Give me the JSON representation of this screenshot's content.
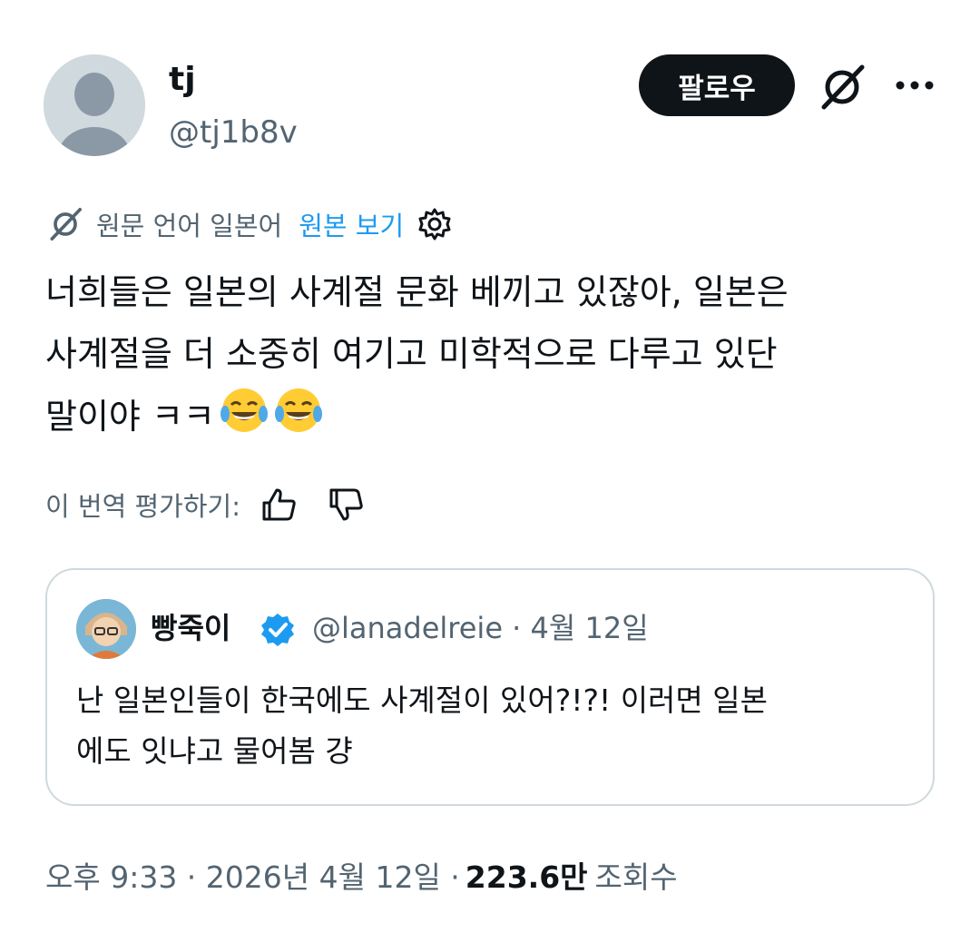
{
  "author": {
    "name": "tj",
    "handle": "@tj1b8v"
  },
  "actions": {
    "follow_label": "팔로우"
  },
  "translation": {
    "source_language": "원문 언어 일본어",
    "view_original": "원본 보기"
  },
  "tweet": {
    "text_line1": "너희들은 일본의 사계절 문화 베끼고 있잖아, 일본은",
    "text_line2": "사계절을 더 소중히 여기고 미학적으로 다루고 있단",
    "text_line3": "말이야 ㅋㅋ",
    "emoji": "face-with-tears-of-joy"
  },
  "rating": {
    "label": "이 번역 평가하기:"
  },
  "quote": {
    "name": "빵죽이",
    "handle_date": "@lanadelreie · 4월 12일",
    "text_line1": "난 일본인들이 한국에도 사계절이 있어?!?! 이러면 일본",
    "text_line2": "에도 잇냐고 물어봄 걍"
  },
  "footer": {
    "timestamp": "오후 9:33 · 2026년 4월 12일 · ",
    "views": "223.6만",
    "views_label": "조회수"
  },
  "colors": {
    "text": "#0f1419",
    "secondary": "#536471",
    "link": "#1d9bf0",
    "border": "#cfd9de",
    "verified": "#1d9bf0"
  }
}
